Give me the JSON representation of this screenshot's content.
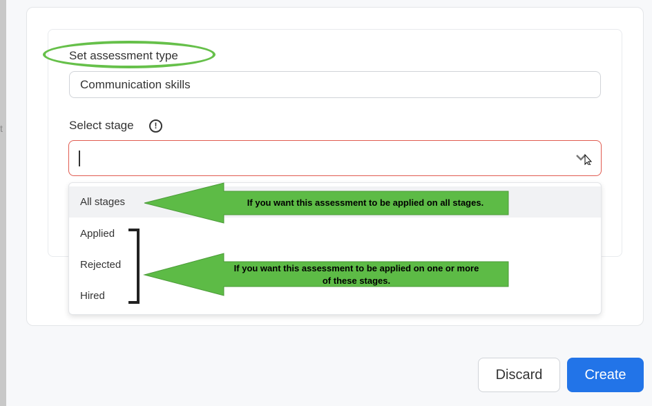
{
  "stray_text": "t",
  "form": {
    "type_label": "Set assessment type",
    "type_value": "Communication skills",
    "stage_label": "Select stage",
    "stage_info_icon": "info-icon",
    "stage_value": ""
  },
  "dropdown": {
    "options": [
      {
        "label": "All stages"
      },
      {
        "label": "Applied"
      },
      {
        "label": "Rejected"
      },
      {
        "label": "Hired"
      }
    ]
  },
  "annotations": {
    "all_stages_note": "If you want this assessment to be applied on all stages.",
    "some_stages_note_line1": "If you want this assessment to be applied on one or more",
    "some_stages_note_line2": "of these stages."
  },
  "footer": {
    "discard_label": "Discard",
    "create_label": "Create"
  },
  "colors": {
    "accent": "#2274e8",
    "error_border": "#e05a4f",
    "annotation_green": "#5dbb46"
  }
}
